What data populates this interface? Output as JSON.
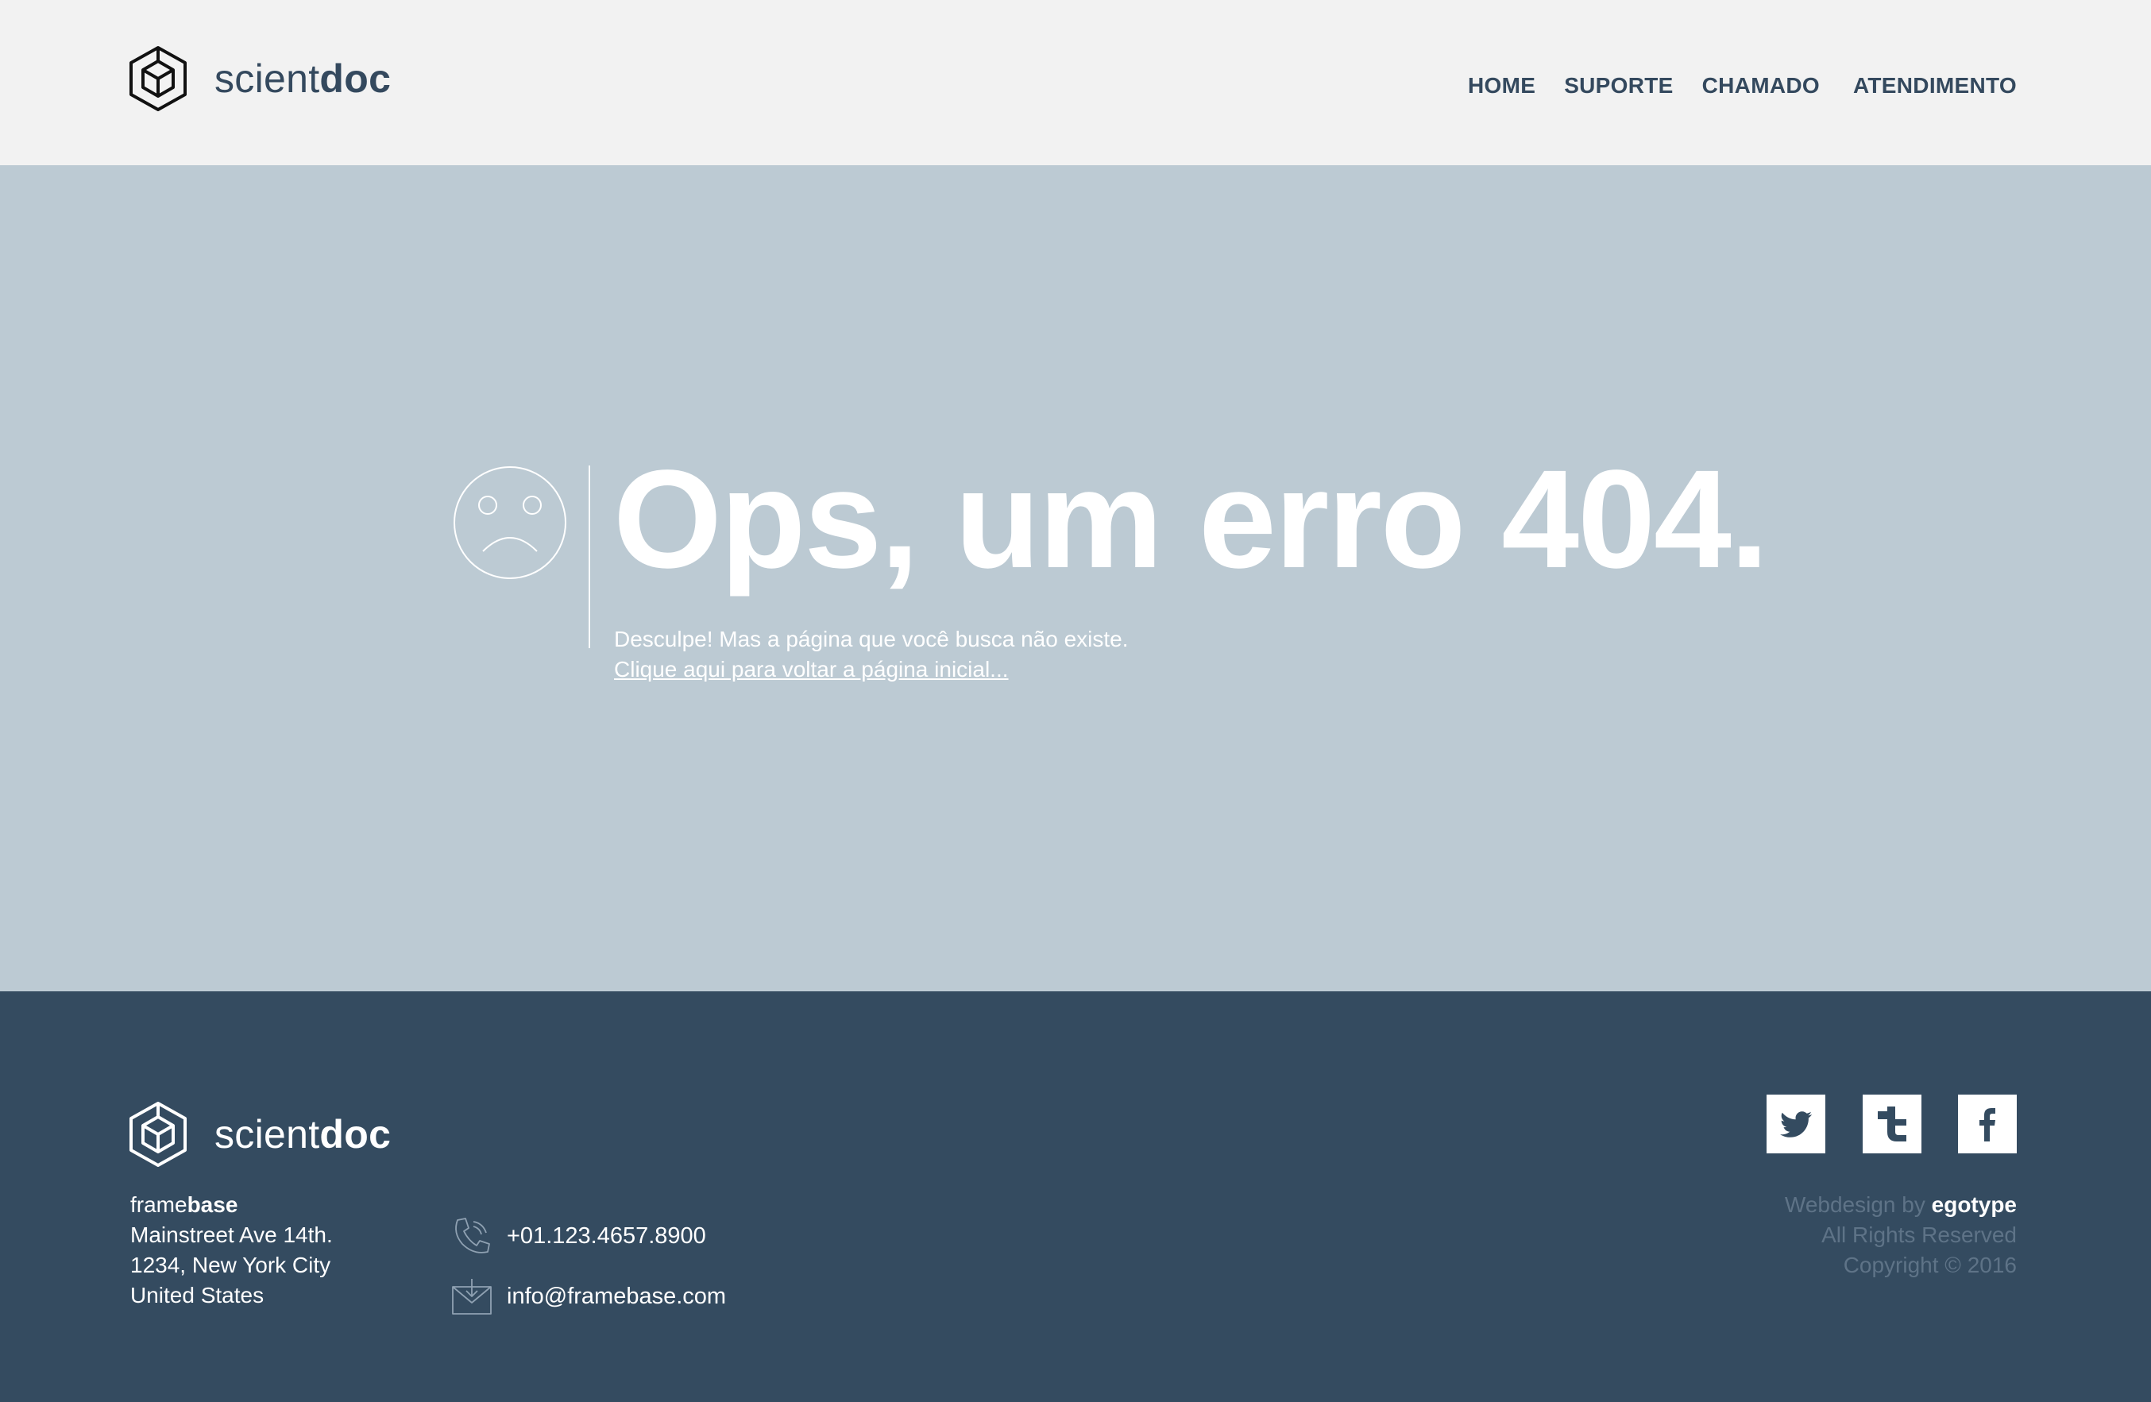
{
  "header": {
    "logo": {
      "text_light": "scient",
      "text_bold": "doc"
    },
    "nav": [
      {
        "label": "HOME"
      },
      {
        "label": "SUPORTE"
      },
      {
        "label": "CHAMADO"
      },
      {
        "label": "ATENDIMENTO"
      }
    ]
  },
  "hero": {
    "title": "Ops, um erro 404.",
    "subtitle": "Desculpe! Mas a página que você busca não existe.",
    "link": "Clique aqui para voltar a página inicial..."
  },
  "footer": {
    "logo": {
      "text_light": "scient",
      "text_bold": "doc"
    },
    "address": {
      "company_light": "frame",
      "company_bold": "base",
      "street": "Mainstreet Ave 14th.",
      "city": "1234, New York City",
      "country": "United States"
    },
    "contact": {
      "phone": "+01.123.4657.8900",
      "email": "info@framebase.com"
    },
    "social": [
      {
        "icon": "twitter-icon"
      },
      {
        "icon": "tumblr-icon"
      },
      {
        "icon": "facebook-icon"
      }
    ],
    "credits": {
      "webdesign_prefix": "Webdesign by ",
      "webdesign_name": "egotype",
      "rights": "All Rights Reserved",
      "copyright": "Copyright © 2016"
    }
  },
  "colors": {
    "header_bg": "#f2f2f2",
    "hero_bg": "#bccad3",
    "footer_bg": "#344b60",
    "brand_text": "#34495e",
    "muted_text": "#5e7387"
  }
}
